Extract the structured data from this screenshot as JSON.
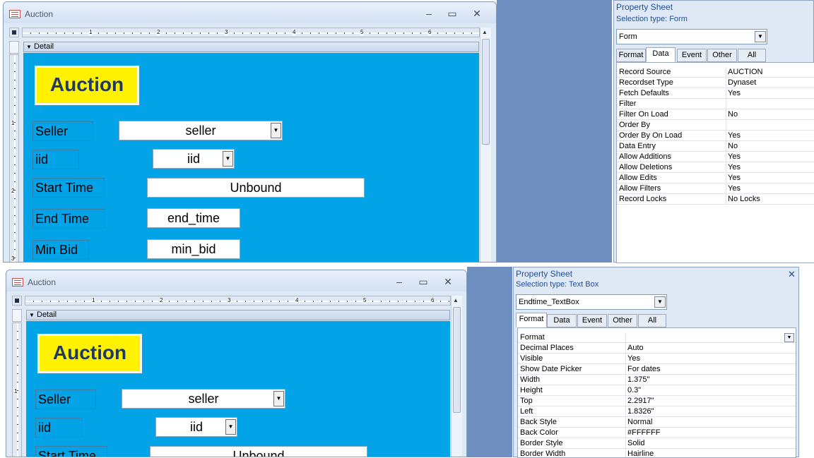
{
  "top_window": {
    "title": "Auction",
    "min": "‒",
    "max": "▭",
    "close": "✕",
    "detail": "Detail",
    "ruler_h": [
      "1",
      "2",
      "3",
      "4",
      "5",
      "6"
    ],
    "ruler_v": [
      "1",
      "2",
      "3"
    ],
    "form_title": "Auction",
    "labels": [
      "Seller",
      "iid",
      "Start Time",
      "End Time",
      "Min Bid"
    ],
    "fields": [
      "seller",
      "iid",
      "Unbound",
      "end_time",
      "min_bid"
    ]
  },
  "bottom_window": {
    "title": "Auction",
    "min": "‒",
    "max": "▭",
    "close": "✕",
    "detail": "Detail",
    "ruler_h": [
      "1",
      "2",
      "3",
      "4",
      "5",
      "6"
    ],
    "ruler_v": [
      "1"
    ],
    "form_title": "Auction",
    "labels": [
      "Seller",
      "iid",
      "Start Time"
    ],
    "fields": [
      "seller",
      "iid",
      "Unbound"
    ]
  },
  "top_sheet": {
    "title": "Property Sheet",
    "selection_type": "Selection type:  Form",
    "selector": "Form",
    "tabs": [
      "Format",
      "Data",
      "Event",
      "Other",
      "All"
    ],
    "active_tab": "Data",
    "rows": [
      {
        "name": "Record Source",
        "value": "AUCTION"
      },
      {
        "name": "Recordset Type",
        "value": "Dynaset"
      },
      {
        "name": "Fetch Defaults",
        "value": "Yes"
      },
      {
        "name": "Filter",
        "value": ""
      },
      {
        "name": "Filter On Load",
        "value": "No"
      },
      {
        "name": "Order By",
        "value": ""
      },
      {
        "name": "Order By On Load",
        "value": "Yes"
      },
      {
        "name": "Data Entry",
        "value": "No"
      },
      {
        "name": "Allow Additions",
        "value": "Yes"
      },
      {
        "name": "Allow Deletions",
        "value": "Yes"
      },
      {
        "name": "Allow Edits",
        "value": "Yes"
      },
      {
        "name": "Allow Filters",
        "value": "Yes"
      },
      {
        "name": "Record Locks",
        "value": "No Locks"
      }
    ]
  },
  "bottom_sheet": {
    "title": "Property Sheet",
    "close": "✕",
    "selection_type": "Selection type:  Text Box",
    "selector": "Endtime_TextBox",
    "tabs": [
      "Format",
      "Data",
      "Event",
      "Other",
      "All"
    ],
    "active_tab": "Format",
    "rows": [
      {
        "name": "Format",
        "value": ""
      },
      {
        "name": "Decimal Places",
        "value": "Auto"
      },
      {
        "name": "Visible",
        "value": "Yes"
      },
      {
        "name": "Show Date Picker",
        "value": "For dates"
      },
      {
        "name": "Width",
        "value": "1.375\""
      },
      {
        "name": "Height",
        "value": "0.3\""
      },
      {
        "name": "Top",
        "value": "2.2917\""
      },
      {
        "name": "Left",
        "value": "1.8326\""
      },
      {
        "name": "Back Style",
        "value": "Normal"
      },
      {
        "name": "Back Color",
        "value": "#FFFFFF"
      },
      {
        "name": "Border Style",
        "value": "Solid"
      },
      {
        "name": "Border Width",
        "value": "Hairline"
      }
    ]
  }
}
